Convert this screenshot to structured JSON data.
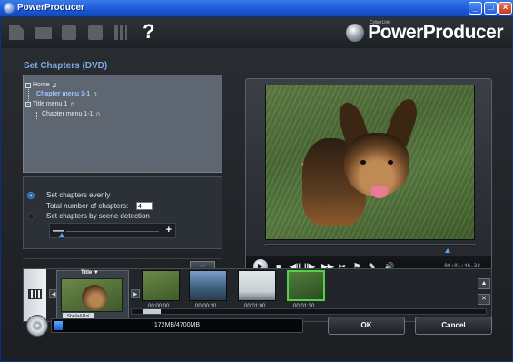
{
  "window": {
    "title": "PowerProducer"
  },
  "brand": {
    "sub": "CyberLink",
    "name": "PowerProducer"
  },
  "toolbar": {
    "help_glyph": "?"
  },
  "section": {
    "title": "Set Chapters (DVD)"
  },
  "menu_tree": {
    "items": [
      {
        "label": "Home",
        "note": "♫"
      },
      {
        "label": "Chapter menu 1-1",
        "note": "♫"
      },
      {
        "label": "Title menu 1",
        "note": "♫"
      },
      {
        "label": "Chapter menu 1-1",
        "note": "♫"
      }
    ]
  },
  "chapter_options": {
    "evenly_label": "Set chapters evenly",
    "total_label": "Total number of chapters:",
    "total_value": "4",
    "scene_label": "Set chapters by scene detection",
    "minus": "—",
    "plus": "+",
    "apply_label": "▪▪▪"
  },
  "player": {
    "timecode": "00:01:46.33",
    "controls": {
      "stop": "■",
      "prev": "◀||",
      "next": "||▶",
      "ff": "▶▶",
      "play": "▶"
    }
  },
  "filmstrip": {
    "menu_title": "Title ▼",
    "menu_label": "Sheila&Rol",
    "clips": [
      {
        "time": "00:00:00"
      },
      {
        "time": "00:00:30"
      },
      {
        "time": "00:01:00"
      },
      {
        "time": "00:01:30"
      }
    ]
  },
  "footer": {
    "capacity_text": "172MB/4700MB",
    "capacity_fraction": 0.037,
    "ok_label": "OK",
    "cancel_label": "Cancel"
  },
  "colors": {
    "accent": "#7ea9e0",
    "selection": "#52d24a"
  }
}
